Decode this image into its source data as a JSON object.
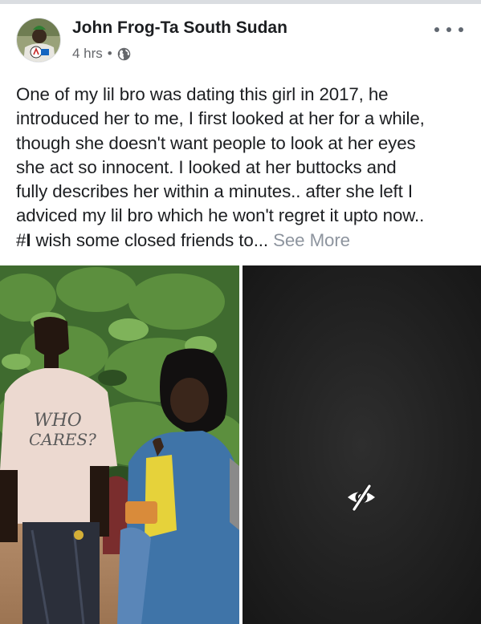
{
  "post": {
    "author": "John Frog-Ta South Sudan",
    "time": "4 hrs",
    "separator": "•",
    "privacy_icon": "globe-icon",
    "more_icon": "more-options-icon",
    "text_lines": [
      "One of my lil bro was dating this girl in 2017, he",
      "introduced her to me, I first looked at her for a while,",
      "though she doesn't want people to look at her eyes",
      "she act so innocent. I looked at her buttocks and",
      "fully describes her within a minutes.. after she left I",
      "adviced my lil bro which he won't regret it upto now.."
    ],
    "last_line_hash": "#",
    "last_line_bold": "I",
    "last_line_rest": " wish some closed friends to",
    "ellipsis": "...",
    "see_more": "See More",
    "see_more_color": "#8d949e"
  },
  "photos": {
    "left": {
      "shirt_text_1": "WHO",
      "shirt_text_2": "CARES?"
    },
    "right": {
      "overlay_icon": "hidden-eye-icon"
    }
  },
  "colors": {
    "text": "#1c1e21",
    "secondary": "#65676b",
    "divider": "#dadde1"
  }
}
